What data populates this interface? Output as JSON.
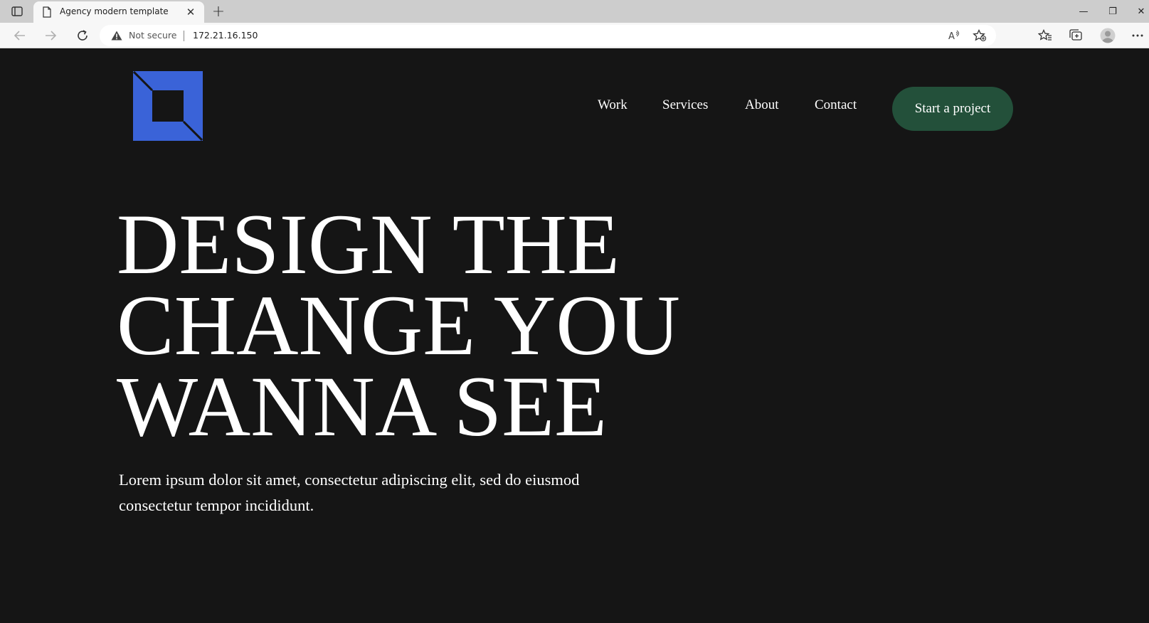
{
  "browser": {
    "tab_title": "Agency modern template",
    "tab_close_glyph": "✕",
    "new_tab_glyph": "+",
    "security_label": "Not secure",
    "url": "172.21.16.150",
    "window_controls": {
      "minimize": "—",
      "restore": "❐",
      "close": "✕"
    },
    "icons": [
      "tab-actions-icon",
      "page-icon",
      "back-icon",
      "forward-icon",
      "refresh-icon",
      "warning-icon",
      "read-aloud-icon",
      "add-favorite-icon",
      "favorites-icon",
      "collections-icon",
      "profile-icon",
      "more-icon"
    ]
  },
  "site": {
    "nav": {
      "items": [
        {
          "label": "Work"
        },
        {
          "label": "Services"
        },
        {
          "label": "About"
        },
        {
          "label": "Contact"
        }
      ],
      "cta_label": "Start a project"
    },
    "hero": {
      "lines": [
        "DESIGN THE",
        "CHANGE YOU",
        "WANNA SEE"
      ],
      "lead": "Lorem ipsum dolor sit amet, consectetur adipiscing elit, sed do eiusmod consectetur tempor incididunt."
    },
    "colors": {
      "background": "#151515",
      "logo_blue": "#3a63d8",
      "cta_green": "#23503a",
      "text": "#ffffff"
    }
  }
}
